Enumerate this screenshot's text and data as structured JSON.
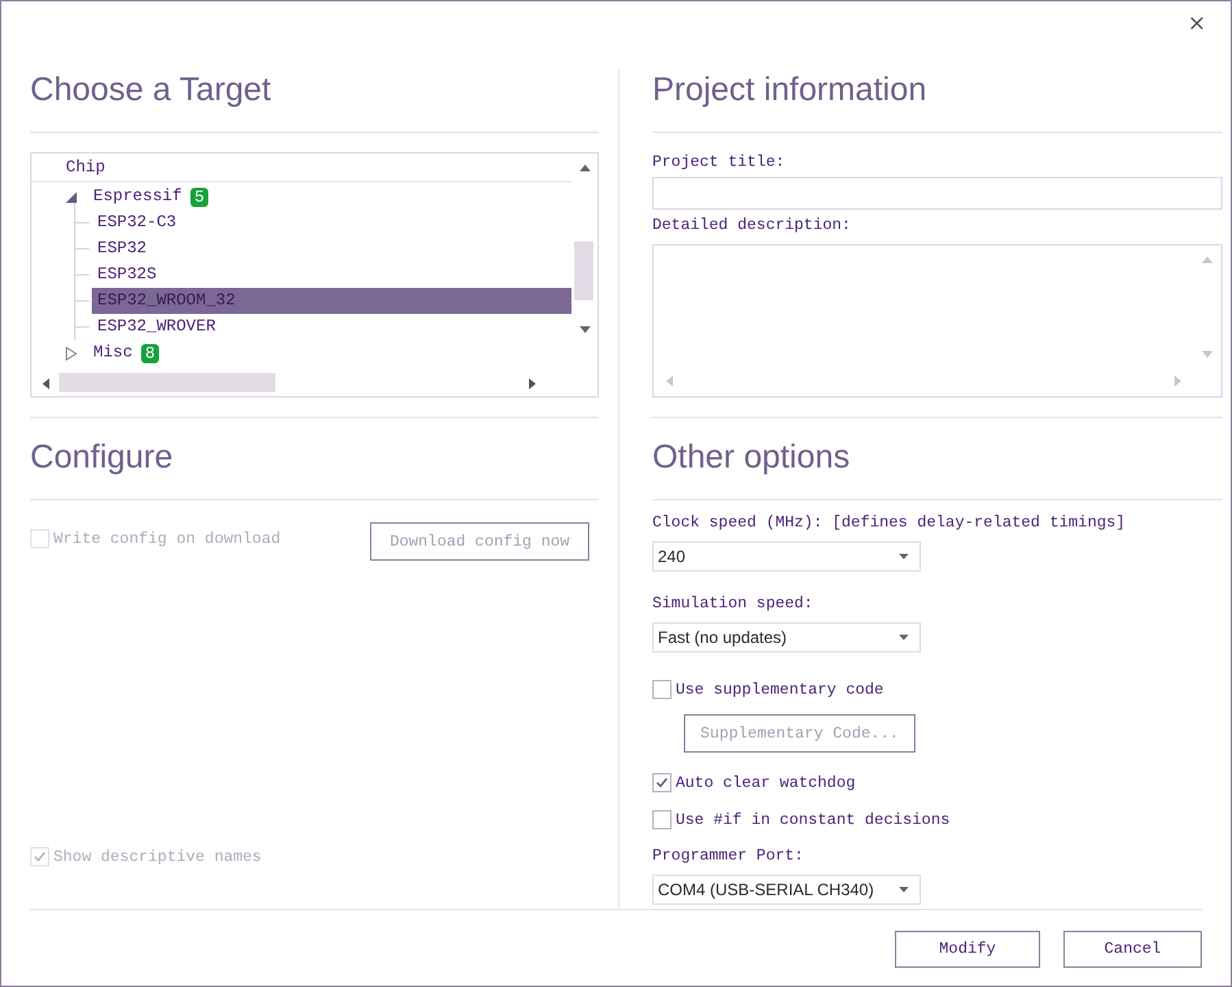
{
  "window": {
    "close_glyph": "×"
  },
  "target": {
    "heading": "Choose a Target",
    "tree": {
      "column_header": "Chip",
      "items": [
        {
          "label": "Espressif",
          "badge": "5",
          "expanded": true,
          "selected": false,
          "children": [
            {
              "label": "ESP32-C3",
              "selected": false
            },
            {
              "label": "ESP32",
              "selected": false
            },
            {
              "label": "ESP32S",
              "selected": false
            },
            {
              "label": "ESP32_WROOM_32",
              "selected": true
            },
            {
              "label": "ESP32_WROVER",
              "selected": false
            }
          ]
        },
        {
          "label": "Misc",
          "badge": "8",
          "expanded": false,
          "selected": false
        }
      ]
    }
  },
  "configure": {
    "heading": "Configure",
    "write_config": {
      "label": "Write config on download",
      "checked": false,
      "disabled": true
    },
    "download_button": {
      "label": "Download config now",
      "disabled": true
    },
    "show_names": {
      "label": "Show descriptive names",
      "checked": true,
      "disabled": true
    }
  },
  "project": {
    "heading": "Project information",
    "title_label": "Project title:",
    "description_label": "Detailed description:"
  },
  "other_options": {
    "heading": "Other options",
    "items": [
      {
        "kind": "combo",
        "label": "Clock speed (MHz): [defines delay-related timings]",
        "value": "240"
      },
      {
        "kind": "combo",
        "label": "Simulation speed:",
        "value": "Fast (no updates)"
      },
      {
        "kind": "checkbox",
        "label": "Use supplementary code",
        "checked": false
      },
      {
        "kind": "button",
        "label": "Supplementary Code...",
        "disabled": true
      },
      {
        "kind": "checkbox",
        "label": "Auto clear watchdog",
        "checked": true
      },
      {
        "kind": "checkbox",
        "label": "Use #if in constant decisions",
        "checked": false
      },
      {
        "kind": "combo",
        "label": "Programmer Port:",
        "value": "COM4 (USB-SERIAL CH340)"
      }
    ]
  },
  "buttons": [
    "Modify",
    "Cancel"
  ]
}
